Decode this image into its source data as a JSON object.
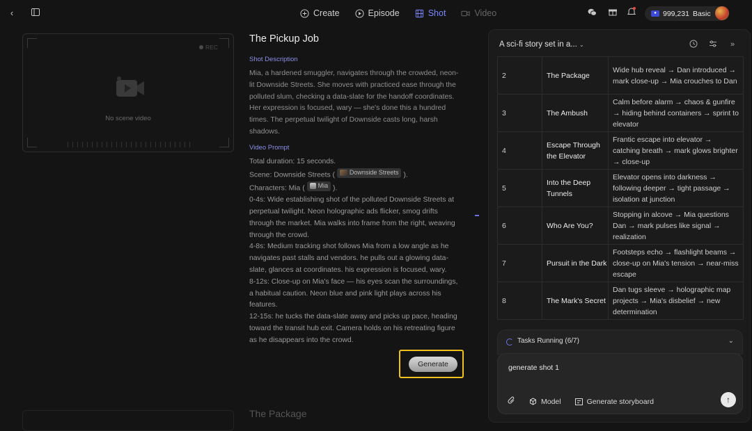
{
  "topbar": {
    "tabs": [
      {
        "label": "Create",
        "icon": "plus-circle-icon"
      },
      {
        "label": "Episode",
        "icon": "episode-icon"
      },
      {
        "label": "Shot",
        "icon": "film-icon"
      },
      {
        "label": "Video",
        "icon": "video-icon"
      }
    ],
    "credits": "999,231",
    "plan": "Basic",
    "accent": "#7b86ff"
  },
  "preview": {
    "rec_label": "REC",
    "empty_label": "No scene video"
  },
  "shot": {
    "title": "The Pickup Job",
    "description_label": "Shot Description",
    "description": "Mia, a hardened smuggler, navigates through the crowded, neon-lit Downside Streets. She moves with practiced ease through the polluted slum, checking a data-slate for the handoff coordinates. Her expression is focused, wary — she's done this a hundred times. The perpetual twilight of Downside casts long, harsh shadows.",
    "prompt_label": "Video Prompt",
    "duration": "Total duration: 15 seconds.",
    "scene_prefix": "Scene: Downside Streets (",
    "scene_chip": "Downside Streets",
    "scene_suffix": ").",
    "characters_prefix": "Characters: Mia (",
    "character_chip": "Mia",
    "characters_suffix": ").",
    "beats": [
      "0-4s: Wide establishing shot of the polluted Downside Streets at perpetual twilight. Neon holographic ads flicker, smog drifts through the market. Mia walks into frame from the right, weaving through the crowd.",
      "4-8s: Medium tracking shot follows Mia from a low angle as he navigates past stalls and vendors. he pulls out a glowing data-slate, glances at coordinates. his expression is focused, wary.",
      "8-12s: Close-up on Mia's face — his eyes scan the surroundings, a habitual caution. Neon blue and pink light plays across his features.",
      "12-15s: he tucks the data-slate away and picks up pace, heading toward the transit hub exit. Camera holds on his retreating figure as he disappears into the crowd."
    ],
    "generate_label": "Generate",
    "next_title": "The Package"
  },
  "panel": {
    "title": "A sci-fi story set in a...",
    "rows": [
      {
        "num": "2",
        "title": "The Package",
        "desc": "Wide hub reveal → Dan introduced → mark close-up → Mia crouches to Dan"
      },
      {
        "num": "3",
        "title": "The Ambush",
        "desc": "Calm before alarm → chaos & gunfire → hiding behind containers → sprint to elevator"
      },
      {
        "num": "4",
        "title": "Escape Through the Elevator",
        "desc": "Frantic escape into elevator → catching breath → mark glows brighter → close-up"
      },
      {
        "num": "5",
        "title": "Into the Deep Tunnels",
        "desc": "Elevator opens into darkness → following deeper → tight passage → isolation at junction"
      },
      {
        "num": "6",
        "title": "Who Are You?",
        "desc": "Stopping in alcove → Mia questions Dan → mark pulses like signal → realization"
      },
      {
        "num": "7",
        "title": "Pursuit in the Dark",
        "desc": "Footsteps echo → flashlight beams → close-up on Mia's tension → near-miss escape"
      },
      {
        "num": "8",
        "title": "The Mark's Secret",
        "desc": "Dan tugs sleeve → holographic map projects → Mia's disbelief → new determination"
      }
    ],
    "tasks_label": "Tasks Running (6/7)",
    "composer_text": "generate shot 1",
    "model_label": "Model",
    "storyboard_label": "Generate storyboard"
  }
}
